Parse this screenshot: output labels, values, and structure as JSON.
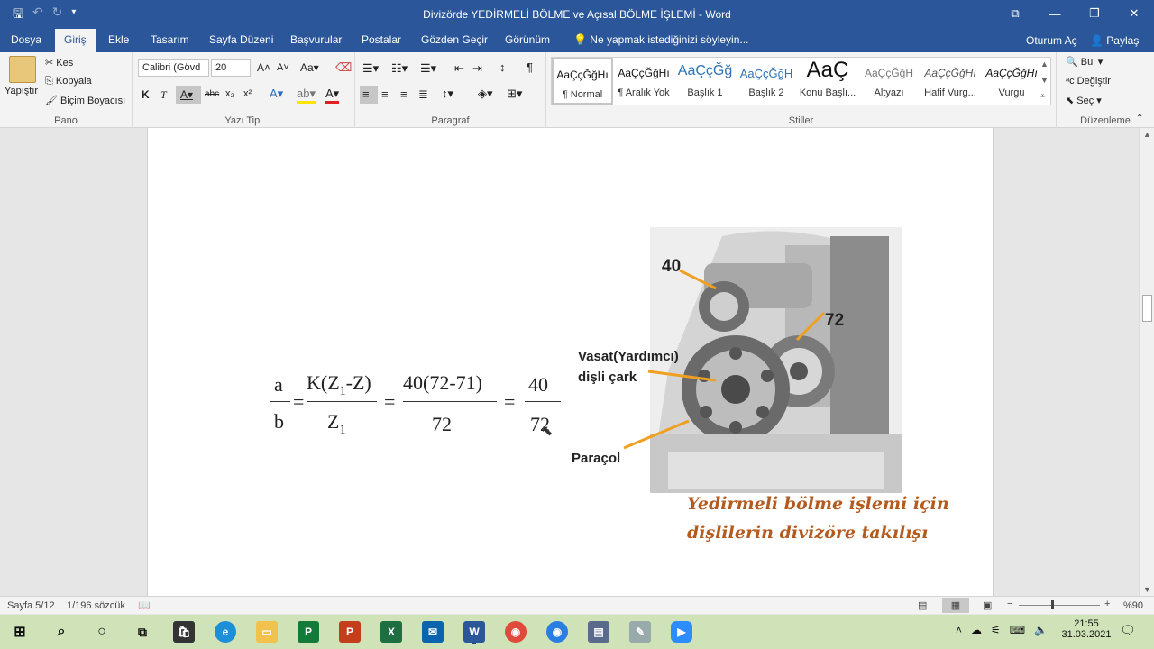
{
  "window": {
    "title": "Divizörde YEDİRMELİ BÖLME ve Açısal BÖLME İŞLEMİ - Word"
  },
  "tabs": [
    "Dosya",
    "Giriş",
    "Ekle",
    "Tasarım",
    "Sayfa Düzeni",
    "Başvurular",
    "Postalar",
    "Gözden Geçir",
    "Görünüm"
  ],
  "tell_me": "Ne yapmak istediğinizi söyleyin...",
  "signin": "Oturum Aç",
  "share": "Paylaş",
  "ribbon": {
    "clipboard": {
      "paste": "Yapıştır",
      "cut": "Kes",
      "copy": "Kopyala",
      "format_painter": "Biçim Boyacısı",
      "label": "Pano"
    },
    "font": {
      "name": "Calibri (Gövd",
      "size": "20",
      "label": "Yazı Tipi"
    },
    "paragraph": {
      "label": "Paragraf"
    },
    "styles": {
      "label": "Stiller",
      "items": [
        {
          "preview": "AaÇçĞğHı",
          "name": "¶ Normal"
        },
        {
          "preview": "AaÇçĞğHı",
          "name": "¶ Aralık Yok"
        },
        {
          "preview": "AaÇçĞğ",
          "name": "Başlık 1"
        },
        {
          "preview": "AaÇçĞğH",
          "name": "Başlık 2"
        },
        {
          "preview": "AaÇ",
          "name": "Konu Başlı..."
        },
        {
          "preview": "AaÇçĞğH",
          "name": "Altyazı"
        },
        {
          "preview": "AaÇçĞğHı",
          "name": "Hafif Vurg..."
        },
        {
          "preview": "AaÇçĞğHı",
          "name": "Vurgu"
        }
      ]
    },
    "editing": {
      "find": "Bul",
      "replace": "Değiştir",
      "select": "Seç",
      "label": "Düzenleme"
    }
  },
  "document": {
    "formula": {
      "lhs_num": "a",
      "lhs_den": "b",
      "f1_num": "K(Z",
      "f1_num_sub": "1",
      "f1_num_tail": "-Z)",
      "f1_den": "Z",
      "f1_den_sub": "1",
      "f2_num": "40(72-71)",
      "f2_den": "72",
      "f3_num": "40",
      "f3_den": "72",
      "eq": "="
    },
    "figure": {
      "label_40": "40",
      "label_72": "72",
      "label_vasat_1": "Vasat(Yardımcı)",
      "label_vasat_2": "dişli çark",
      "label_paracol": "Paraçol",
      "caption_1": "Yedirmeli bölme işlemi için",
      "caption_2": "dişlilerin divizöre takılışı"
    }
  },
  "status": {
    "page": "Sayfa 5/12",
    "words": "1/196 sözcük",
    "zoom": "%90"
  },
  "taskbar": {
    "time": "21:55",
    "date": "31.03.2021"
  }
}
